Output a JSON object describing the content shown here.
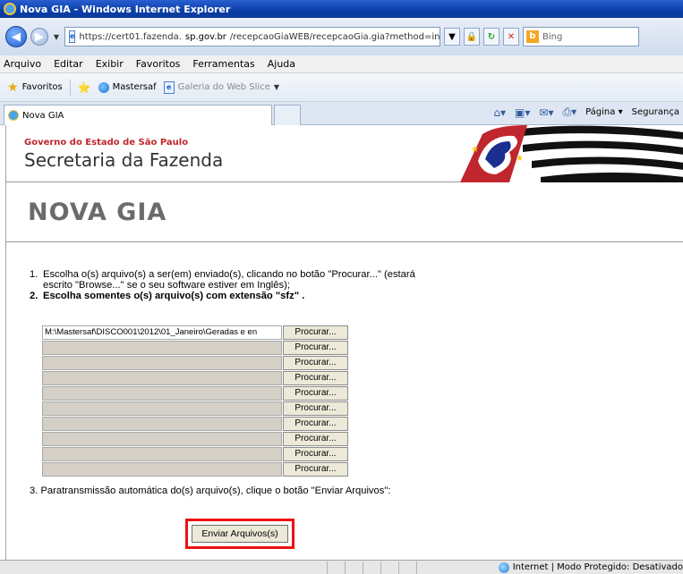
{
  "window": {
    "title": "Nova GIA - Windows Internet Explorer"
  },
  "address": {
    "url_prefix": "https://cert01.fazenda.",
    "url_domain": "sp.gov.br",
    "url_suffix": "/recepcaoGiaWEB/recepcaoGia.gia?method=init&SID",
    "search_placeholder": "Bing"
  },
  "menu": [
    "Arquivo",
    "Editar",
    "Exibir",
    "Favoritos",
    "Ferramentas",
    "Ajuda"
  ],
  "favorites": {
    "label": "Favoritos",
    "items": [
      "Mastersaf",
      "Galeria do Web Slice"
    ]
  },
  "tab": {
    "title": "Nova GIA"
  },
  "commands": {
    "pagina": "Página",
    "seguranca": "Segurança"
  },
  "site": {
    "gov_label": "Governo do Estado de São Paulo",
    "sec_label": "Secretaria da Fazenda"
  },
  "page": {
    "heading": "NOVA GIA",
    "step1_num": "1.",
    "step1_line1": "Escolha o(s) arquivo(s) a ser(em) enviado(s), clicando no botão \"Procurar...\" (estará",
    "step1_line2": "escrito \"Browse...\" se o seu software estiver em Inglês);",
    "step2_num": "2.",
    "step2": "Escolha somentes o(s) arquivo(s) com extensão \"sfz\" .",
    "step3": "3.  Paratransmissão automática do(s) arquivo(s), clique o botão \"Enviar Arquivos\":",
    "files": [
      "M:\\Mastersaf\\DISCO001\\2012\\01_Janeiro\\Geradas e en",
      "",
      "",
      "",
      "",
      "",
      "",
      "",
      "",
      ""
    ],
    "browse_label": "Procurar...",
    "submit_label": "Enviar Arquivos(s)"
  },
  "status": {
    "zone_text": "Internet | Modo Protegido: Desativado"
  },
  "colors": {
    "accent_red": "#e11111",
    "gov_red": "#c0262d"
  }
}
